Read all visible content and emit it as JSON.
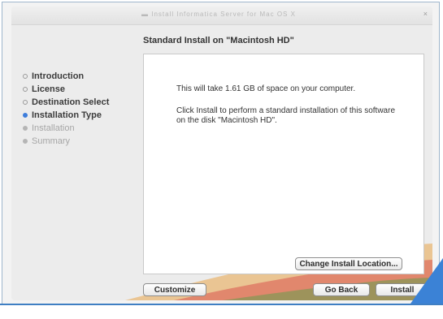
{
  "window": {
    "title": "▬ Install Informatica Server for Mac OS X",
    "close_glyph": "×"
  },
  "heading": "Standard Install on \"Macintosh HD\"",
  "sidebar": {
    "steps": [
      {
        "label": "Introduction",
        "state": "done"
      },
      {
        "label": "License",
        "state": "done"
      },
      {
        "label": "Destination Select",
        "state": "done"
      },
      {
        "label": "Installation Type",
        "state": "current"
      },
      {
        "label": "Installation",
        "state": "future"
      },
      {
        "label": "Summary",
        "state": "future"
      }
    ]
  },
  "content": {
    "message_space": "This will take 1.61 GB of space on your computer.",
    "message_install": "Click Install to perform a standard installation of this software on the disk \"Macintosh HD\"."
  },
  "buttons": {
    "change_location": "Change Install Location...",
    "customize": "Customize",
    "go_back": "Go Back",
    "install": "Install"
  },
  "colors": {
    "current_step": "#3d7ddb",
    "frame_accent": "#3f7fc3"
  }
}
